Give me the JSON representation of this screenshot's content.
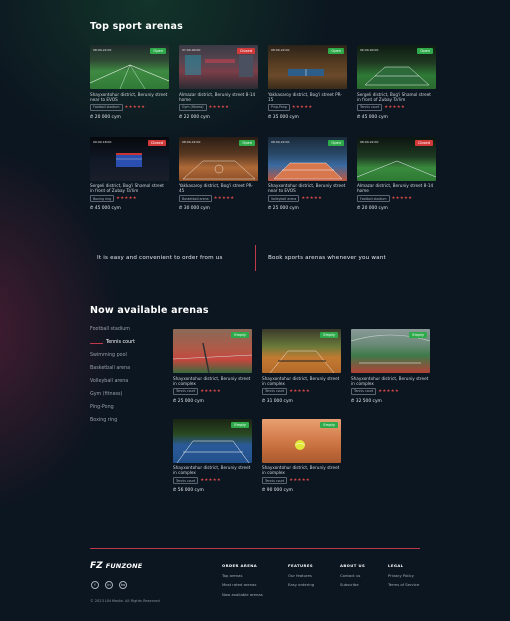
{
  "top": {
    "title": "Top sport arenas",
    "cards": [
      {
        "time": "08:00-22:00",
        "status": "Open",
        "status_type": "open",
        "address": "Shayxontohur district, Beruniy street near to EVOS",
        "tag": "Football stadium",
        "stars": "★★★★★",
        "price": "₾ 20 000 cym"
      },
      {
        "time": "07:00-00:00",
        "status": "Closed",
        "status_type": "closed",
        "address": "Almazar district, Beruniy street 8-14 home",
        "tag": "Gym (fitness)",
        "stars": "★★★★★",
        "price": "₾ 22 000 cym"
      },
      {
        "time": "08:00-22:00",
        "status": "Open",
        "status_type": "open",
        "address": "Yakkasaroy district, Bog'i street PR-15",
        "tag": "Ping-Pong",
        "stars": "★★★★★",
        "price": "₾ 35 000 cym"
      },
      {
        "time": "06:00-00:00",
        "status": "Open",
        "status_type": "open",
        "address": "Sergeli district, Bog'i Shamol street in front of Zubay Ta'lim",
        "tag": "Tennis court",
        "stars": "★★★★★",
        "price": "₾ 45 000 cym"
      },
      {
        "time": "09:00-18:00",
        "status": "Closed",
        "status_type": "closed",
        "address": "Sergeli district, Bog'i Shamol street in front of Zubay Ta'lim",
        "tag": "Boxing ring",
        "stars": "★★★★★",
        "price": "₾ 45 000 cym"
      },
      {
        "time": "08:00-22:00",
        "status": "Open",
        "status_type": "open",
        "address": "Yakkasaroy district, Bog'i street PR-45",
        "tag": "Basketball arena",
        "stars": "★★★★★",
        "price": "₾ 30 000 cym"
      },
      {
        "time": "08:00-22:00",
        "status": "Open",
        "status_type": "open",
        "address": "Shayxontohur district, Beruniy street near to EVOS",
        "tag": "Volleyball arena",
        "stars": "★★★★★",
        "price": "₾ 25 000 cym"
      },
      {
        "time": "08:00-22:00",
        "status": "Closed",
        "status_type": "closed",
        "address": "Almazar district, Beruniy street 8-14 home",
        "tag": "Football stadium",
        "stars": "★★★★★",
        "price": "₾ 20 000 cym"
      }
    ]
  },
  "promo": {
    "left": "It is easy and convenient to order from us",
    "right": "Book sports arenas whenever you want"
  },
  "available": {
    "title": "Now available arenas",
    "categories": [
      "Football stadium",
      "Tennis court",
      "Swimming pool",
      "Basketball arena",
      "Volleyball arena",
      "Gym (fitness)",
      "Ping-Pong",
      "Boxing ring"
    ],
    "cards": [
      {
        "status": "Empty",
        "address": "Shayxontohur district, Beruniy street in complex",
        "tag": "Tennis court",
        "stars": "★★★★★",
        "price": "₾ 25 000 cym"
      },
      {
        "status": "Empty",
        "address": "Shayxontohur district, Beruniy street in complex",
        "tag": "Tennis court",
        "stars": "★★★★★",
        "price": "₾ 31 000 cym"
      },
      {
        "status": "Empty",
        "address": "Shayxontohur district, Beruniy street in complex",
        "tag": "Tennis court",
        "stars": "★★★★★",
        "price": "₾ 32 500 cym"
      },
      {
        "status": "Empty",
        "address": "Shayxontohur district, Beruniy street in complex",
        "tag": "Tennis court",
        "stars": "★★★★★",
        "price": "₾ 56 000 cym"
      },
      {
        "status": "Empty",
        "address": "Shayxontohur district, Beruniy street in complex",
        "tag": "Tennis court",
        "stars": "★★★★★",
        "price": "₾ 90 000 cym"
      }
    ]
  },
  "footer": {
    "logo_mark": "FZ",
    "logo_text": "FUNZONE",
    "social": [
      "f",
      "in",
      "tw"
    ],
    "copyright": "© 2023 LIN Media. All Rights Reserved",
    "columns": [
      {
        "title": "ORDER ARENA",
        "links": [
          "Top arenas",
          "Most rated arenas",
          "Now available arenas"
        ]
      },
      {
        "title": "FEATURES",
        "links": [
          "Our features",
          "Easy ordering"
        ]
      },
      {
        "title": "ABOUT US",
        "links": [
          "Contact us",
          "Subscribe"
        ]
      },
      {
        "title": "LEGAL",
        "links": [
          "Privacy Policy",
          "Terms of Service"
        ]
      }
    ]
  },
  "colors": {
    "accent": "#c0394b",
    "open": "#2faa4a",
    "closed": "#d23a3a",
    "background": "#0c1620"
  }
}
